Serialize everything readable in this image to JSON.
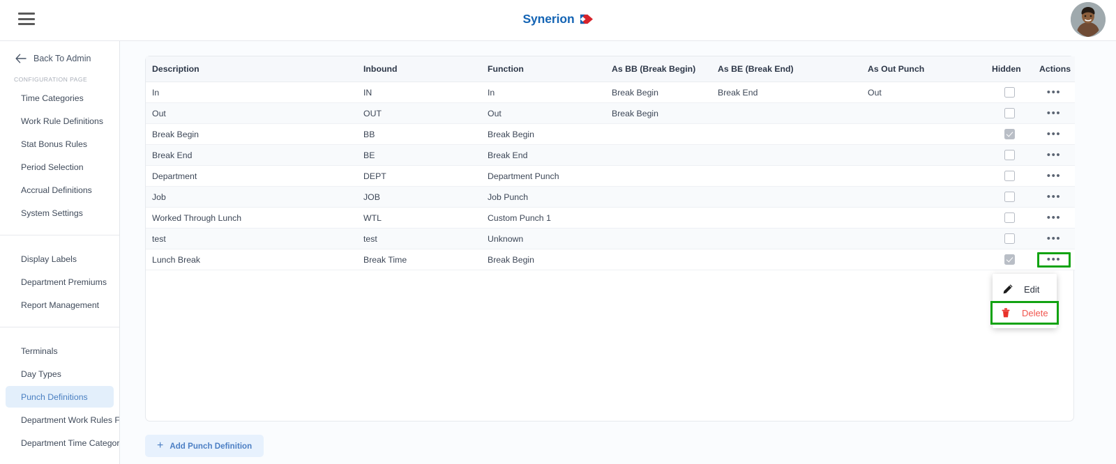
{
  "header": {
    "menu_icon": "hamburger-icon",
    "brand_name": "Synerion",
    "brand_mark_icon": "synerion-arrow-logo",
    "avatar_icon": "user-avatar"
  },
  "sidebar": {
    "back_link": {
      "label": "Back To Admin",
      "icon": "arrow-left-icon"
    },
    "section_label": "CONFIGURATION PAGE",
    "groups": [
      {
        "items": [
          {
            "label": "Time Categories",
            "active": false
          },
          {
            "label": "Work Rule Definitions",
            "active": false
          },
          {
            "label": "Stat Bonus Rules",
            "active": false
          },
          {
            "label": "Period Selection",
            "active": false
          },
          {
            "label": "Accrual Definitions",
            "active": false
          },
          {
            "label": "System Settings",
            "active": false
          }
        ]
      },
      {
        "items": [
          {
            "label": "Display Labels",
            "active": false
          },
          {
            "label": "Department Premiums",
            "active": false
          },
          {
            "label": "Report Management",
            "active": false
          }
        ]
      },
      {
        "items": [
          {
            "label": "Terminals",
            "active": false
          },
          {
            "label": "Day Types",
            "active": false
          },
          {
            "label": "Punch Definitions",
            "active": true
          },
          {
            "label": "Department Work Rules Filt...",
            "active": false
          },
          {
            "label": "Department Time Category ...",
            "active": false
          }
        ]
      }
    ]
  },
  "table": {
    "columns": [
      "Description",
      "Inbound",
      "Function",
      "As BB (Break Begin)",
      "As BE (Break End)",
      "As Out Punch",
      "Hidden",
      "Actions"
    ],
    "rows": [
      {
        "description": "In",
        "inbound": "IN",
        "function": "In",
        "as_bb": "Break Begin",
        "as_be": "Break End",
        "as_out": "Out",
        "hidden": false
      },
      {
        "description": "Out",
        "inbound": "OUT",
        "function": "Out",
        "as_bb": "Break Begin",
        "as_be": "",
        "as_out": "",
        "hidden": false
      },
      {
        "description": "Break Begin",
        "inbound": "BB",
        "function": "Break Begin",
        "as_bb": "",
        "as_be": "",
        "as_out": "",
        "hidden": true
      },
      {
        "description": "Break End",
        "inbound": "BE",
        "function": "Break End",
        "as_bb": "",
        "as_be": "",
        "as_out": "",
        "hidden": false
      },
      {
        "description": "Department",
        "inbound": "DEPT",
        "function": "Department Punch",
        "as_bb": "",
        "as_be": "",
        "as_out": "",
        "hidden": false
      },
      {
        "description": "Job",
        "inbound": "JOB",
        "function": "Job Punch",
        "as_bb": "",
        "as_be": "",
        "as_out": "",
        "hidden": false
      },
      {
        "description": "Worked Through Lunch",
        "inbound": "WTL",
        "function": "Custom Punch 1",
        "as_bb": "",
        "as_be": "",
        "as_out": "",
        "hidden": false
      },
      {
        "description": "test",
        "inbound": "test",
        "function": "Unknown",
        "as_bb": "",
        "as_be": "",
        "as_out": "",
        "hidden": false
      },
      {
        "description": "Lunch Break",
        "inbound": "Break Time",
        "function": "Break Begin",
        "as_bb": "",
        "as_be": "",
        "as_out": "",
        "hidden": true
      }
    ],
    "actions_glyph": "•••"
  },
  "add_button": {
    "label": "Add Punch Definition",
    "icon": "plus-icon"
  },
  "context_menu": {
    "items": [
      {
        "label": "Edit",
        "icon": "pencil-icon",
        "highlighted": false
      },
      {
        "label": "Delete",
        "icon": "trash-icon",
        "highlighted": true
      }
    ]
  },
  "colors": {
    "brand_blue": "#1464b4",
    "accent_link": "#4c7fc4",
    "active_nav_bg": "#e3effb",
    "delete_red": "#f0554e",
    "highlight_green": "#12a312",
    "page_bg": "#fafcfe",
    "header_row_bg": "#f6f8fb"
  }
}
